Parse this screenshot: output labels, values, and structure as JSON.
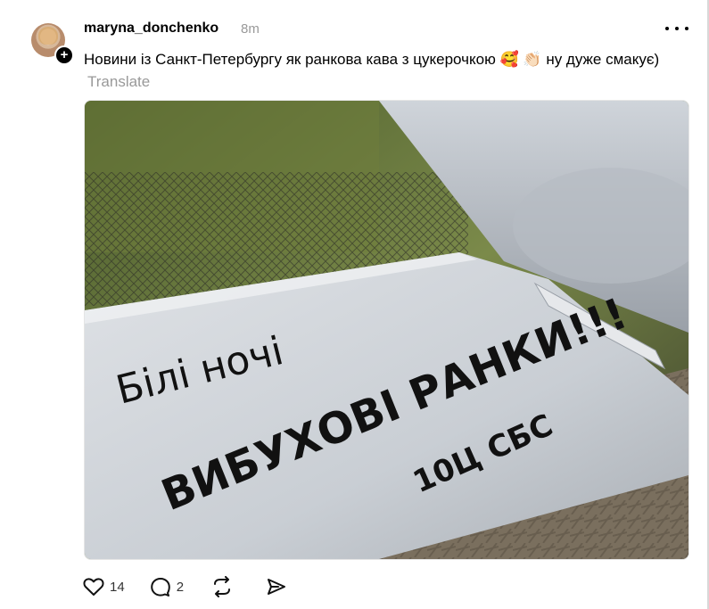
{
  "post": {
    "username": "maryna_donchenko",
    "time": "8m",
    "text_line": "Новини із Санкт-Петербургу як ранкова кава з цукерочкою 🥰 👏🏻 ну дуже смакує)",
    "translate_label": "Translate",
    "follow_symbol": "+"
  },
  "image": {
    "line1": "Білі ночі",
    "line2": "ВИБУХОВІ РАНКИ!!!",
    "line3": "10Ц СБС"
  },
  "actions": {
    "likes": "14",
    "replies": "2"
  },
  "icons": [
    "more-icon",
    "heart-icon",
    "reply-icon",
    "repost-icon",
    "share-icon"
  ]
}
